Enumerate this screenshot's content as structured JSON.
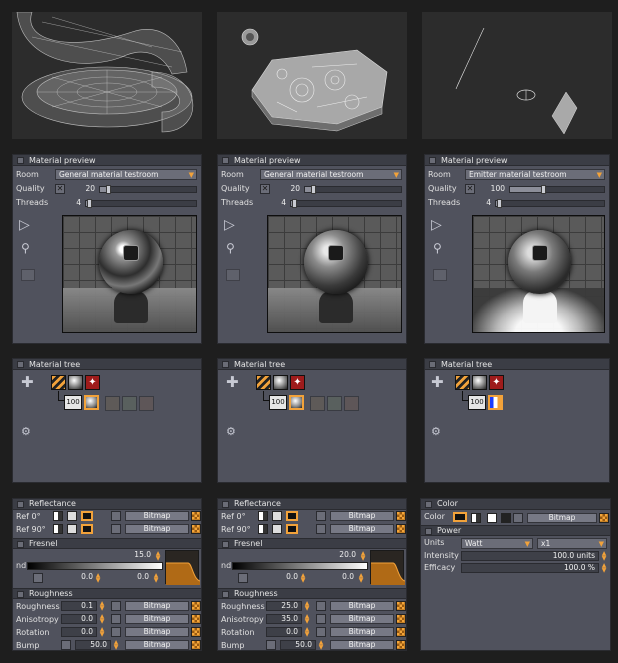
{
  "preview_panels": [
    {
      "title": "Material preview",
      "room_label": "Room",
      "room_value": "General material testroom",
      "quality_label": "Quality",
      "quality_value": "20",
      "quality_fraction": 0.08,
      "threads_label": "Threads",
      "threads_value": "4",
      "threads_fraction": 0.03,
      "material_style": "chrome",
      "tree_title": "Material tree",
      "tree_value": "100"
    },
    {
      "title": "Material preview",
      "room_label": "Room",
      "room_value": "General material testroom",
      "quality_label": "Quality",
      "quality_value": "20",
      "quality_fraction": 0.08,
      "threads_label": "Threads",
      "threads_value": "4",
      "threads_fraction": 0.03,
      "material_style": "satin",
      "tree_title": "Material tree",
      "tree_value": "100"
    },
    {
      "title": "Material preview",
      "room_label": "Room",
      "room_value": "Emitter material testroom",
      "quality_label": "Quality",
      "quality_value": "100",
      "quality_fraction": 0.35,
      "threads_label": "Threads",
      "threads_value": "4",
      "threads_fraction": 0.03,
      "material_style": "emitter",
      "tree_title": "Material tree",
      "tree_value": "100"
    }
  ],
  "reflect_panels": [
    {
      "reflectance_title": "Reflectance",
      "ref0_label": "Ref 0°",
      "ref90_label": "Ref 90°",
      "bitmap_label": "Bitmap",
      "fresnel_title": "Fresnel",
      "nd_label": "nd",
      "nd_value": "15.0",
      "fresnel_a": "0.0",
      "fresnel_b": "0.0",
      "roughness_title": "Roughness",
      "roughness_label": "Roughness",
      "roughness_value": "0.1",
      "anisotropy_label": "Anisotropy",
      "anisotropy_value": "0.0",
      "rotation_label": "Rotation",
      "rotation_value": "0.0",
      "bump_label": "Bump",
      "bump_value": "50.0"
    },
    {
      "reflectance_title": "Reflectance",
      "ref0_label": "Ref 0°",
      "ref90_label": "Ref 90°",
      "bitmap_label": "Bitmap",
      "fresnel_title": "Fresnel",
      "nd_label": "nd",
      "nd_value": "20.0",
      "fresnel_a": "0.0",
      "fresnel_b": "0.0",
      "roughness_title": "Roughness",
      "roughness_label": "Roughness",
      "roughness_value": "25.0",
      "anisotropy_label": "Anisotropy",
      "anisotropy_value": "35.0",
      "rotation_label": "Rotation",
      "rotation_value": "0.0",
      "bump_label": "Bump",
      "bump_value": "50.0"
    }
  ],
  "emitter_panel": {
    "color_title": "Color",
    "color_label": "Color",
    "bitmap_label": "Bitmap",
    "power_title": "Power",
    "units_label": "Units",
    "units_value": "Watt",
    "multiplier_value": "x1",
    "intensity_label": "Intensity",
    "intensity_value": "100.0 units",
    "efficacy_label": "Efficacy",
    "efficacy_value": "100.0 %"
  },
  "colors": {
    "accent": "#f2a23a",
    "panel_bg": "#50525d",
    "title_bg": "#3b3d45"
  }
}
